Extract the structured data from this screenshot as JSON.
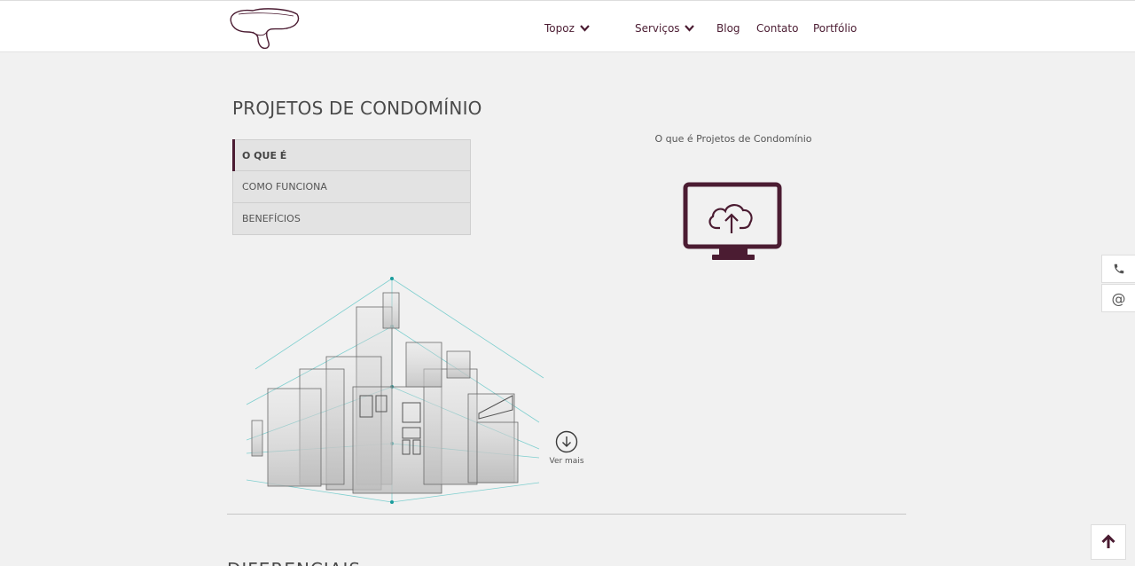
{
  "header": {
    "nav": [
      {
        "label": "Topoz",
        "has_dropdown": true
      },
      {
        "label": "Serviços",
        "has_dropdown": true
      },
      {
        "label": "Blog",
        "has_dropdown": false
      },
      {
        "label": "Contato",
        "has_dropdown": false
      },
      {
        "label": "Portfólio",
        "has_dropdown": false
      }
    ]
  },
  "main": {
    "title": "PROJETOS DE CONDOMÍNIO",
    "tabs": [
      {
        "label": "O QUE É",
        "active": true
      },
      {
        "label": "COMO FUNCIONA",
        "active": false
      },
      {
        "label": "BENEFÍCIOS",
        "active": false
      }
    ],
    "panel": {
      "title": "O que é Projetos de Condomínio",
      "icon": "cloud-upload-monitor-icon"
    },
    "ver_mais": "Ver mais",
    "next_section": "DIFERENCIAIS"
  },
  "floating": {
    "phone_icon": "phone-icon",
    "mail_icon": "at-sign-icon",
    "scroll_top_icon": "arrow-up-icon"
  },
  "colors": {
    "accent": "#4b1c32",
    "background": "#f1f1f1",
    "tab_bg": "#e3e3e3",
    "illustration_line": "#5cc7c7"
  }
}
